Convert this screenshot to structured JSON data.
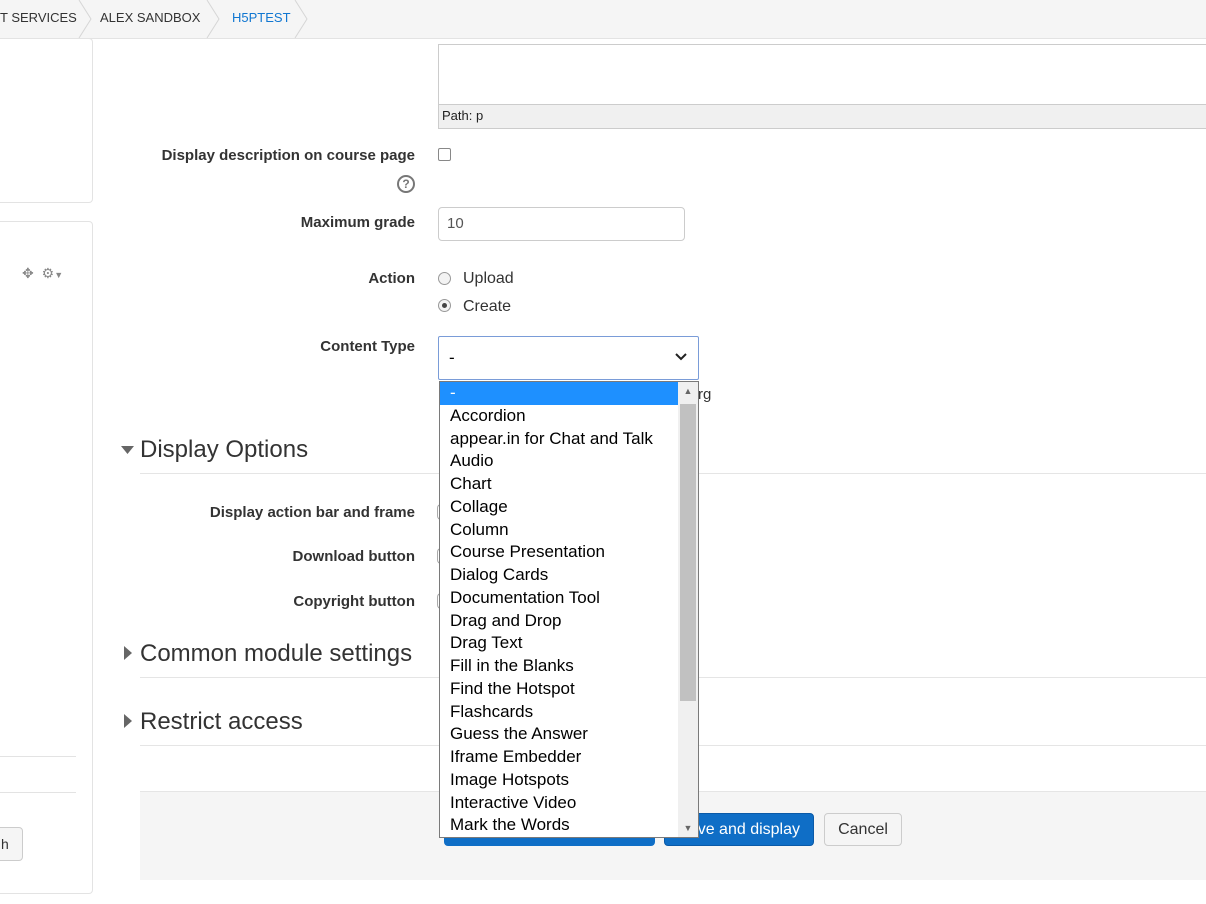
{
  "breadcrumb": {
    "items": [
      "T SERVICES",
      "ALEX SANDBOX",
      "H5PTEST"
    ]
  },
  "editor": {
    "path_label": "Path: p"
  },
  "form": {
    "display_description_label": "Display description on course page",
    "display_description_checked": false,
    "max_grade_label": "Maximum grade",
    "max_grade_value": "10",
    "action_label": "Action",
    "action_options": [
      "Upload",
      "Create"
    ],
    "action_selected": "Create",
    "content_type_label": "Content Type",
    "content_type_value": "-",
    "obscured_text": "rg"
  },
  "sections": {
    "display_options": "Display Options",
    "display_action_bar_label": "Display action bar and frame",
    "download_button_label": "Download button",
    "copyright_button_label": "Copyright button",
    "common_module_settings": "Common module settings",
    "restrict_access": "Restrict access"
  },
  "footer": {
    "save_display_label": "ve and display",
    "cancel_label": "Cancel"
  },
  "sidebar": {
    "button_fragment": "h"
  },
  "dropdown": {
    "options": [
      "-",
      "Accordion",
      "appear.in for Chat and Talk",
      "Audio",
      "Chart",
      "Collage",
      "Column",
      "Course Presentation",
      "Dialog Cards",
      "Documentation Tool",
      "Drag and Drop",
      "Drag Text",
      "Fill in the Blanks",
      "Find the Hotspot",
      "Flashcards",
      "Guess the Answer",
      "Iframe Embedder",
      "Image Hotspots",
      "Interactive Video",
      "Mark the Words"
    ],
    "selected_index": 0
  },
  "colors": {
    "link_blue": "#1177d1",
    "primary_button": "#0f6ec6",
    "selection": "#1e90ff"
  }
}
